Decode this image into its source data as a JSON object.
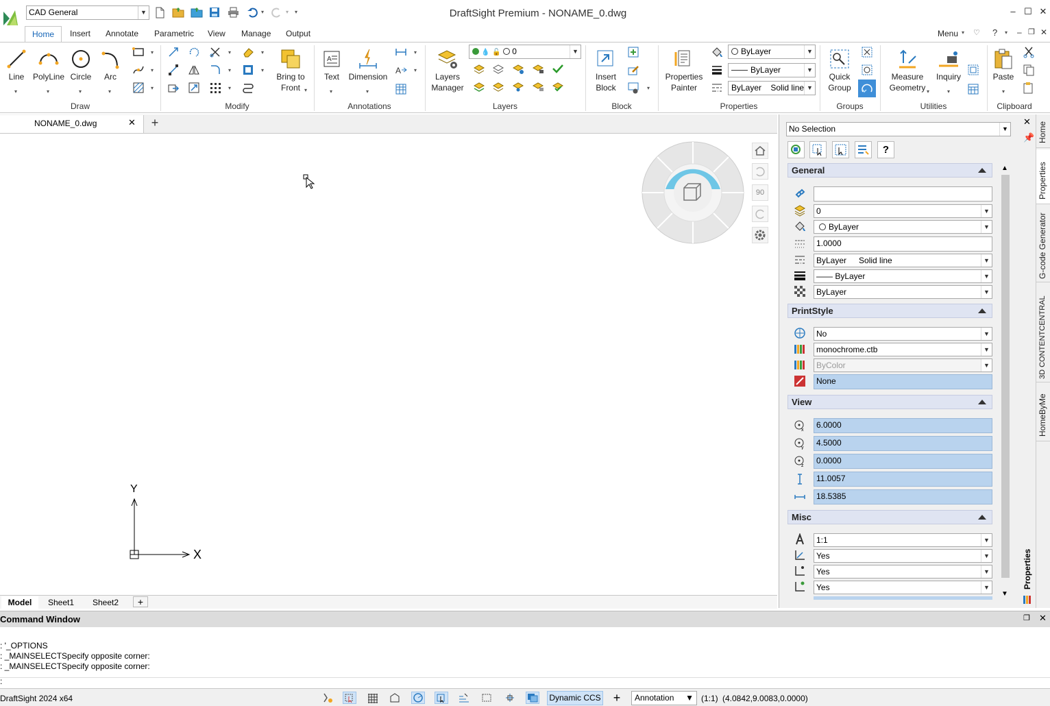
{
  "app": {
    "title": "DraftSight Premium - NONAME_0.dwg",
    "workspace": "CAD General",
    "menu_label": "Menu"
  },
  "ribbon_tabs": [
    "Home",
    "Insert",
    "Annotate",
    "Parametric",
    "View",
    "Manage",
    "Output"
  ],
  "ribbon": {
    "draw": {
      "label": "Draw",
      "line": "Line",
      "polyline": "PolyLine",
      "circle": "Circle",
      "arc": "Arc"
    },
    "modify": {
      "label": "Modify",
      "bring_to_front_1": "Bring to",
      "bring_to_front_2": "Front"
    },
    "annotations": {
      "label": "Annotations",
      "text": "Text",
      "dimension": "Dimension"
    },
    "layers": {
      "label": "Layers",
      "manager_1": "Layers",
      "manager_2": "Manager",
      "layer_value": "0"
    },
    "block": {
      "label": "Block",
      "insert_1": "Insert",
      "insert_2": "Block"
    },
    "properties": {
      "label": "Properties",
      "painter_1": "Properties",
      "painter_2": "Painter",
      "color": "ByLayer",
      "lineweight": "ByLayer",
      "linetype_1": "ByLayer",
      "linetype_2": "Solid line"
    },
    "groups": {
      "label": "Groups",
      "quick_1": "Quick",
      "quick_2": "Group"
    },
    "utilities": {
      "label": "Utilities",
      "measure_1": "Measure",
      "measure_2": "Geometry",
      "inquiry": "Inquiry"
    },
    "clipboard": {
      "label": "Clipboard",
      "paste": "Paste"
    }
  },
  "document": {
    "tab": "NONAME_0.dwg"
  },
  "viewcube": {
    "angle": "90"
  },
  "axes": {
    "x": "X",
    "y": "Y"
  },
  "sheets": [
    "Model",
    "Sheet1",
    "Sheet2"
  ],
  "properties_panel": {
    "selection": "No Selection",
    "general": {
      "title": "General",
      "hyperlink": "",
      "layer": "0",
      "color": "ByLayer",
      "linetype_scale": "1.0000",
      "linetype_1": "ByLayer",
      "linetype_2": "Solid line",
      "lineweight": "—— ByLayer",
      "transparency": "ByLayer"
    },
    "printstyle": {
      "title": "PrintStyle",
      "enabled": "No",
      "table": "monochrome.ctb",
      "style": "ByColor",
      "attached": "None"
    },
    "view": {
      "title": "View",
      "center_x": "6.0000",
      "center_y": "4.5000",
      "center_z": "0.0000",
      "height": "11.0057",
      "width": "18.5385"
    },
    "misc": {
      "title": "Misc",
      "annotation_scale": "1:1",
      "ccs_icon_on": "Yes",
      "ccs_icon_origin": "Yes",
      "ccs_per_viewport": "Yes"
    }
  },
  "side_tabs": [
    "Home",
    "Properties",
    "G-code Generator",
    "3D CONTENTCENTRAL",
    "HomeByMe"
  ],
  "side_panel_label": "Properties",
  "command_window": {
    "title": "Command Window",
    "lines": [
      ": '_OPTIONS",
      ": _MAINSELECTSpecify opposite corner:",
      ": _MAINSELECTSpecify opposite corner:"
    ],
    "prompt": ":"
  },
  "status": {
    "version": "DraftSight 2024 x64",
    "dynamic_ccs": "Dynamic CCS",
    "annotation": "Annotation",
    "scale": "(1:1)",
    "coords": "(4.0842,9.0083,0.0000)"
  },
  "colors": {
    "accent": "#1565b7",
    "highlight": "#b9d3ee",
    "section": "#dfe4f2",
    "viewcube": "#6ec6e6"
  }
}
